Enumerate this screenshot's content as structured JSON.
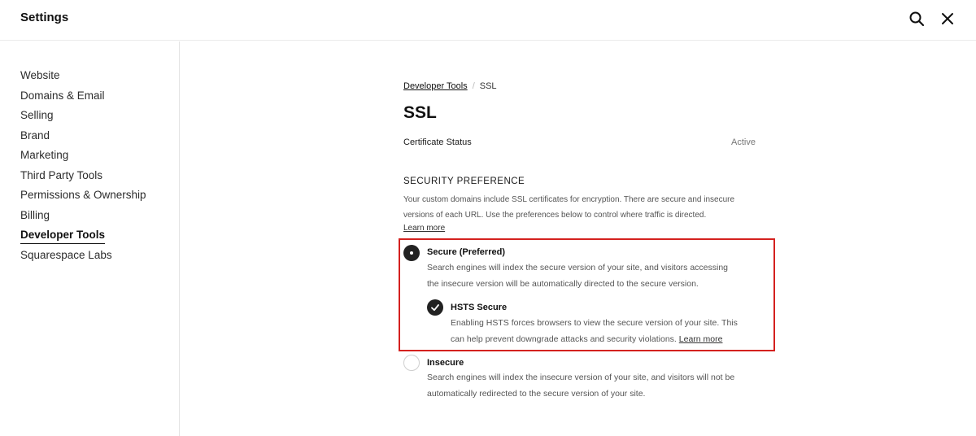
{
  "header": {
    "title": "Settings",
    "search_icon": "search-icon",
    "close_icon": "close-icon"
  },
  "sidebar": {
    "items": [
      {
        "label": "Website",
        "active": false
      },
      {
        "label": "Domains & Email",
        "active": false
      },
      {
        "label": "Selling",
        "active": false
      },
      {
        "label": "Brand",
        "active": false
      },
      {
        "label": "Marketing",
        "active": false
      },
      {
        "label": "Third Party Tools",
        "active": false
      },
      {
        "label": "Permissions & Ownership",
        "active": false
      },
      {
        "label": "Billing",
        "active": false
      },
      {
        "label": "Developer Tools",
        "active": true
      },
      {
        "label": "Squarespace Labs",
        "active": false
      }
    ]
  },
  "breadcrumb": {
    "parent": "Developer Tools",
    "separator": "/",
    "current": "SSL"
  },
  "page": {
    "title": "SSL"
  },
  "certificate": {
    "label": "Certificate Status",
    "value": "Active"
  },
  "security": {
    "heading": "SECURITY PREFERENCE",
    "desc_line1": "Your custom domains include SSL certificates for encryption. There are secure and insecure",
    "desc_line2": "versions of each URL. Use the preferences below to control where traffic is directed.",
    "learn_more": "Learn more",
    "secure": {
      "title": "Secure (Preferred)",
      "desc_line1": "Search engines will index the secure version of your site, and visitors accessing",
      "desc_line2": "the insecure version will be automatically directed to the secure version.",
      "selected": true
    },
    "hsts": {
      "title": "HSTS Secure",
      "desc_line1": "Enabling HSTS forces browsers to view the secure version of your site. This",
      "desc_line2": "can help prevent downgrade attacks and security violations.",
      "learn_more": "Learn more",
      "checked": true
    },
    "insecure": {
      "title": "Insecure",
      "desc_line1": "Search engines will index the insecure version of your site, and visitors will not be",
      "desc_line2": "automatically redirected to the secure version of your site.",
      "selected": false
    }
  },
  "colors": {
    "highlight": "#d4211f",
    "control_fill": "#222222"
  }
}
